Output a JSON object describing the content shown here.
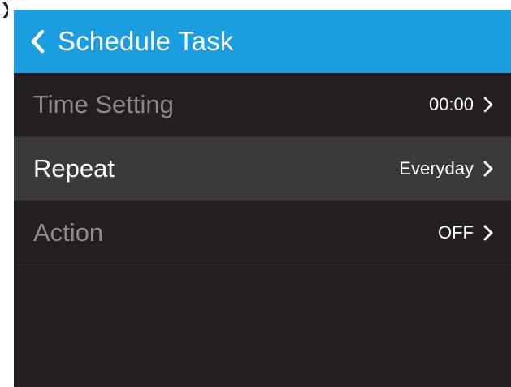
{
  "header": {
    "title": "Schedule Task"
  },
  "rows": [
    {
      "label": "Time Setting",
      "value": "00:00",
      "selected": false
    },
    {
      "label": "Repeat",
      "value": "Everyday",
      "selected": true
    },
    {
      "label": "Action",
      "value": "OFF",
      "selected": false
    }
  ],
  "colors": {
    "header_bg": "#1a9ee0",
    "screen_bg": "#231f20",
    "selected_row_bg": "#3b3a3a",
    "label_dim": "#8c8a8a",
    "text_primary": "#ffffff"
  },
  "icons": {
    "back": "chevron-left-icon",
    "row_arrow": "chevron-right-icon"
  }
}
